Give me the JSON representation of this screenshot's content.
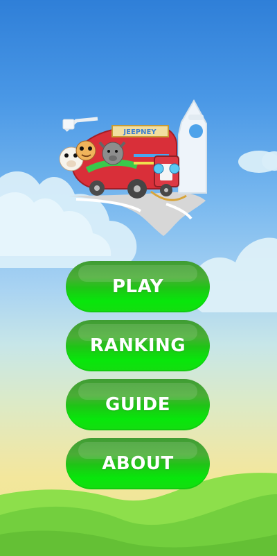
{
  "logo": {
    "icon": "jeepney-logo",
    "text": "JEEPNEY"
  },
  "menu": {
    "buttons": [
      {
        "label": "PLAY"
      },
      {
        "label": "RANKING"
      },
      {
        "label": "GUIDE"
      },
      {
        "label": "ABOUT"
      }
    ]
  },
  "colors": {
    "sky_top": "#2f7fd8",
    "sky_bottom": "#e9e493",
    "button_green": "#08e60b",
    "cloud_white": "#ffffff",
    "hill_green": "#7bd840"
  }
}
